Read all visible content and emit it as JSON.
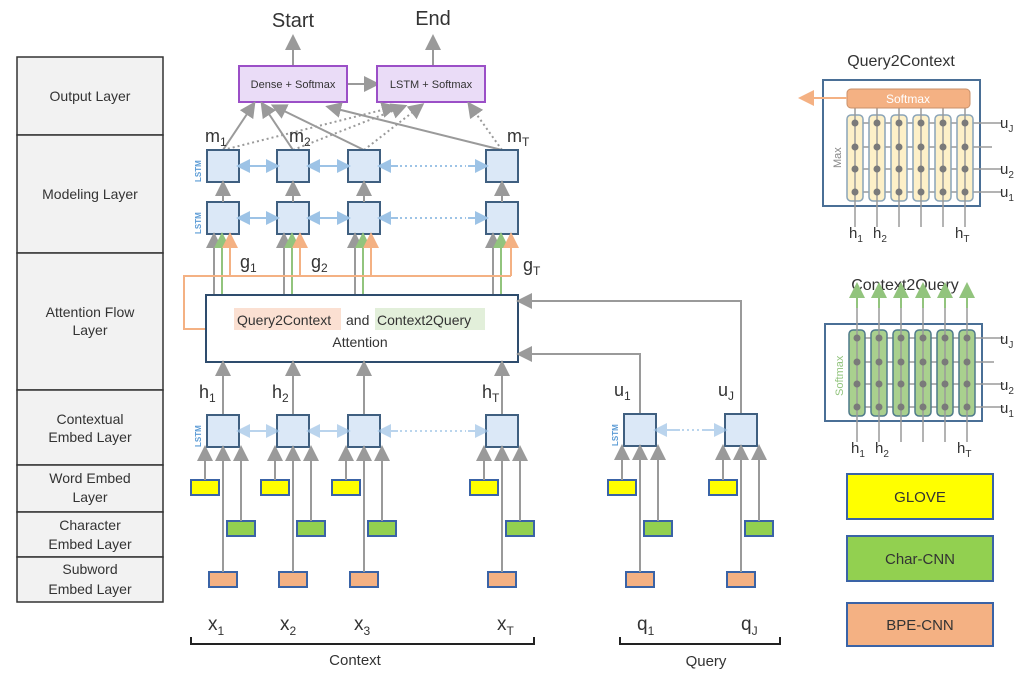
{
  "layers": [
    {
      "id": "output",
      "lines": [
        "Output Layer"
      ]
    },
    {
      "id": "modeling",
      "lines": [
        "Modeling Layer"
      ]
    },
    {
      "id": "attention",
      "lines": [
        "Attention Flow",
        "Layer"
      ]
    },
    {
      "id": "contextual",
      "lines": [
        "Contextual",
        "Embed Layer"
      ]
    },
    {
      "id": "word",
      "lines": [
        "Word Embed",
        "Layer"
      ]
    },
    {
      "id": "character",
      "lines": [
        "Character",
        "Embed Layer"
      ]
    },
    {
      "id": "subword",
      "lines": [
        "Subword",
        "Embed Layer"
      ]
    }
  ],
  "outputs": {
    "start": "Start",
    "end": "End"
  },
  "output_blocks": {
    "dense": "Dense + Softmax",
    "lstm": "LSTM + Softmax"
  },
  "lstm_tag": "LSTM",
  "modeling_labels": {
    "m1": "m",
    "m1_sub": "1",
    "m2": "m",
    "m2_sub": "2",
    "mT": "m",
    "mT_sub": "T"
  },
  "g_labels": {
    "g1": "g",
    "g1_sub": "1",
    "g2": "g",
    "g2_sub": "2",
    "gT": "g",
    "gT_sub": "T"
  },
  "attention_block": {
    "q2c": "Query2Context",
    "and": "and",
    "c2q": "Context2Query",
    "line2": "Attention"
  },
  "h_labels": {
    "h1": "h",
    "h1_sub": "1",
    "h2": "h",
    "h2_sub": "2",
    "hT": "h",
    "hT_sub": "T"
  },
  "u_labels": {
    "u1": "u",
    "u1_sub": "1",
    "uJ": "u",
    "uJ_sub": "J"
  },
  "context_tokens": [
    {
      "base": "x",
      "sub": "1"
    },
    {
      "base": "x",
      "sub": "2"
    },
    {
      "base": "x",
      "sub": "3"
    },
    {
      "base": "x",
      "sub": "T"
    }
  ],
  "query_tokens": [
    {
      "base": "q",
      "sub": "1"
    },
    {
      "base": "q",
      "sub": "J"
    }
  ],
  "groups": {
    "context": "Context",
    "query": "Query"
  },
  "q2c_panel": {
    "title": "Query2Context",
    "softmax": "Softmax",
    "side_label": "Max",
    "right_labels": [
      {
        "base": "u",
        "sub": "J"
      },
      {
        "base": "u",
        "sub": "2"
      },
      {
        "base": "u",
        "sub": "1"
      }
    ],
    "bottom_labels": [
      {
        "base": "h",
        "sub": "1"
      },
      {
        "base": "h",
        "sub": "2"
      },
      {
        "base": "h",
        "sub": "T"
      }
    ]
  },
  "c2q_panel": {
    "title": "Context2Query",
    "side_label": "Softmax",
    "right_labels": [
      {
        "base": "u",
        "sub": "J"
      },
      {
        "base": "u",
        "sub": "2"
      },
      {
        "base": "u",
        "sub": "1"
      }
    ],
    "bottom_labels": [
      {
        "base": "h",
        "sub": "1"
      },
      {
        "base": "h",
        "sub": "2"
      },
      {
        "base": "h",
        "sub": "T"
      }
    ]
  },
  "legend": [
    {
      "label": "GLOVE",
      "color": "#ffff00"
    },
    {
      "label": "Char-CNN",
      "color": "#92d050"
    },
    {
      "label": "BPE-CNN",
      "color": "#f4b183"
    }
  ],
  "colors": {
    "lstm_fill": "#dbe8f7",
    "output_fill": "#eadcf7",
    "output_stroke": "#9b4fc7",
    "q2c_highlight": "#fbe0d2",
    "c2q_highlight": "#e2efda",
    "arrow_gray": "#9a9a9a",
    "arrow_green": "#92c47d",
    "arrow_orange": "#f4b183"
  }
}
